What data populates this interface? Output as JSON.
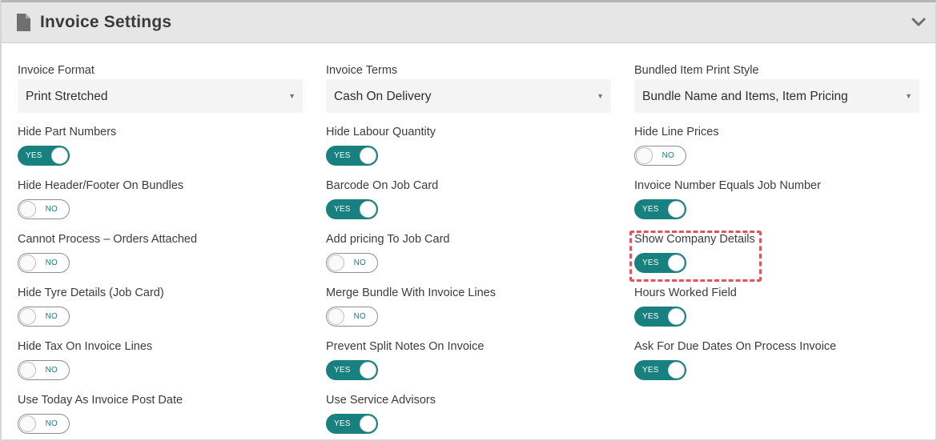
{
  "panel": {
    "title": "Invoice Settings",
    "icon": "document-icon",
    "collapse_icon": "chevron-down-icon"
  },
  "selects": [
    {
      "label": "Invoice Format",
      "value": "Print Stretched"
    },
    {
      "label": "Invoice Terms",
      "value": "Cash On Delivery"
    },
    {
      "label": "Bundled Item Print Style",
      "value": "Bundle Name and Items, Item Pricing"
    }
  ],
  "toggle_text": {
    "on": "YES",
    "off": "NO"
  },
  "toggles": [
    {
      "label": "Hide Part Numbers",
      "state": "YES",
      "on": true
    },
    {
      "label": "Hide Labour Quantity",
      "state": "YES",
      "on": true
    },
    {
      "label": "Hide Line Prices",
      "state": "NO",
      "on": false
    },
    {
      "label": "Hide Header/Footer On Bundles",
      "state": "NO",
      "on": false
    },
    {
      "label": "Barcode On Job Card",
      "state": "YES",
      "on": true
    },
    {
      "label": "Invoice Number Equals Job Number",
      "state": "YES",
      "on": true
    },
    {
      "label": "Cannot Process – Orders Attached",
      "state": "NO",
      "on": false
    },
    {
      "label": "Add pricing To Job Card",
      "state": "NO",
      "on": false
    },
    {
      "label": "Show Company Details",
      "state": "YES",
      "on": true
    },
    {
      "label": "Hide Tyre Details (Job Card)",
      "state": "NO",
      "on": false
    },
    {
      "label": "Merge Bundle With Invoice Lines",
      "state": "NO",
      "on": false
    },
    {
      "label": "Hours Worked Field",
      "state": "YES",
      "on": true
    },
    {
      "label": "Hide Tax On Invoice Lines",
      "state": "NO",
      "on": false
    },
    {
      "label": "Prevent Split Notes On Invoice",
      "state": "YES",
      "on": true
    },
    {
      "label": "Ask For Due Dates On Process Invoice",
      "state": "YES",
      "on": true
    },
    {
      "label": "Use Today As Invoice Post Date",
      "state": "NO",
      "on": false
    },
    {
      "label": "Use Service Advisors",
      "state": "YES",
      "on": true
    }
  ],
  "colors": {
    "accent": "#18807e",
    "highlight": "#e0555a",
    "header_bg": "#e6e6e6"
  }
}
